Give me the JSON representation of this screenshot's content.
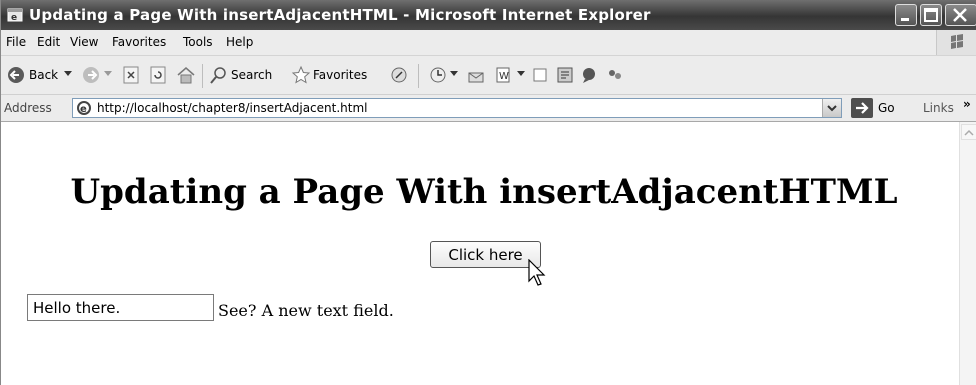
{
  "window": {
    "title": "Updating a Page With insertAdjacentHTML - Microsoft Internet Explorer"
  },
  "menu": [
    "File",
    "Edit",
    "View",
    "Favorites",
    "Tools",
    "Help"
  ],
  "toolbar": {
    "back_label": "Back",
    "search_label": "Search",
    "favorites_label": "Favorites"
  },
  "address": {
    "label": "Address",
    "url": "http://localhost/chapter8/insertAdjacent.html",
    "go_label": "Go",
    "links_label": "Links",
    "links_chevron": "»"
  },
  "page": {
    "heading": "Updating a Page With insertAdjacentHTML",
    "button_label": "Click here",
    "text_field_value": "Hello there.",
    "note": "See? A new text field."
  }
}
